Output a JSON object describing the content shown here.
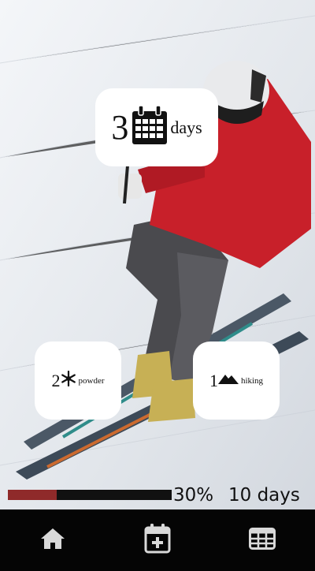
{
  "stats": {
    "days_count": "3",
    "days_label": "days",
    "powder_count": "2",
    "powder_label": "powder",
    "hiking_count": "1",
    "hiking_label": "hiking"
  },
  "progress": {
    "percent_text": "30%",
    "value": 0.3,
    "goal_text": "10 days"
  },
  "colors": {
    "progress_fill": "#8f2a2a",
    "progress_track": "#111111",
    "nav_background": "#050505",
    "nav_icon": "#d9d9d9"
  },
  "nav": {
    "items": [
      {
        "icon": "home-icon"
      },
      {
        "icon": "calendar-add-icon"
      },
      {
        "icon": "table-grid-icon"
      }
    ]
  }
}
